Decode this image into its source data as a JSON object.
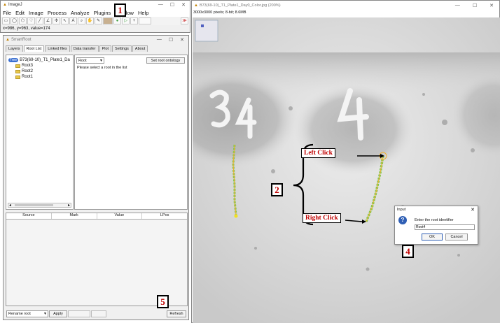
{
  "imagej": {
    "title": "ImageJ",
    "menu": [
      "File",
      "Edit",
      "Image",
      "Process",
      "Analyze",
      "Plugins",
      "Window",
      "Help"
    ],
    "status": "x=986, y=963, value=174"
  },
  "smartroot": {
    "title": "SmartRoot",
    "tabs": [
      "Layers",
      "Root List",
      "Linked files",
      "Data transfer",
      "Plot",
      "Settings",
      "About"
    ],
    "active_tab": "Root List",
    "tree_root": "B73(69-10)_T1_Plate1_Da",
    "tree_badge": "Tree",
    "tree_items": [
      "Root3",
      "Root2",
      "Root1"
    ],
    "root_select": "Root",
    "set_ontology": "Set root ontology",
    "hint": "Please select a root in the list",
    "table_headers": [
      "Source",
      "Mark",
      "Value",
      "LPos"
    ],
    "rename_select": "Rename root",
    "apply": "Apply",
    "refresh": "Refresh"
  },
  "image_window": {
    "title": "B73(69-10)_T1_Plate1_Day0_Color.jpg (200%)",
    "info": "3000x3000 pixels; 8-bit; 8.6MB",
    "plate_numbers": [
      "3",
      "4"
    ]
  },
  "input_dialog": {
    "title": "Input",
    "prompt": "Enter the root identifier",
    "value": "Root4",
    "ok": "OK",
    "cancel": "Cancel"
  },
  "callouts": [
    "1",
    "2",
    "3",
    "4",
    "5"
  ],
  "annotations": {
    "left_click": "Left Click",
    "right_click": "Right Click"
  },
  "colors": {
    "callout_text": "#c00000",
    "root_trace": "#7ec850",
    "root_marker": "#f0b030"
  }
}
